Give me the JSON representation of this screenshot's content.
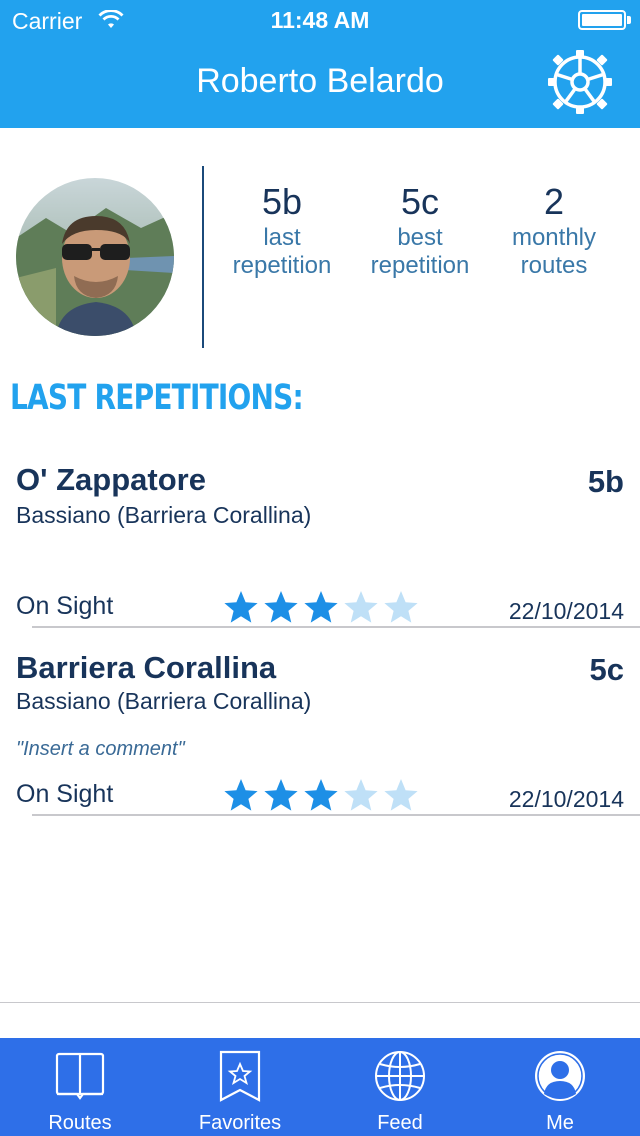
{
  "status": {
    "carrier": "Carrier",
    "time": "11:48 AM"
  },
  "nav": {
    "title": "Roberto Belardo"
  },
  "profile": {
    "stats": [
      {
        "value": "5b",
        "label1": "last",
        "label2": "repetition"
      },
      {
        "value": "5c",
        "label1": "best",
        "label2": "repetition"
      },
      {
        "value": "2",
        "label1": "monthly",
        "label2": "routes"
      }
    ]
  },
  "section": {
    "title": "LAST REPETITIONS:"
  },
  "repetitions": [
    {
      "name": "O' Zappatore",
      "grade": "5b",
      "place": "Bassiano (Barriera Corallina)",
      "comment": "",
      "style": "On Sight",
      "rating": 3,
      "max_rating": 5,
      "date": "22/10/2014"
    },
    {
      "name": "Barriera Corallina",
      "grade": "5c",
      "place": "Bassiano (Barriera Corallina)",
      "comment": "\"Insert a comment\"",
      "style": "On Sight",
      "rating": 3,
      "max_rating": 5,
      "date": "22/10/2014"
    }
  ],
  "tabs": [
    {
      "label": "Routes",
      "icon": "book-icon"
    },
    {
      "label": "Favorites",
      "icon": "bookmark-star-icon"
    },
    {
      "label": "Feed",
      "icon": "globe-icon"
    },
    {
      "label": "Me",
      "icon": "person-icon"
    }
  ],
  "colors": {
    "header": "#22a2ee",
    "tabbar": "#2e6fe8",
    "text_dark": "#18345a",
    "star_filled": "#1d8fe6",
    "star_empty": "#bfe0f7"
  }
}
